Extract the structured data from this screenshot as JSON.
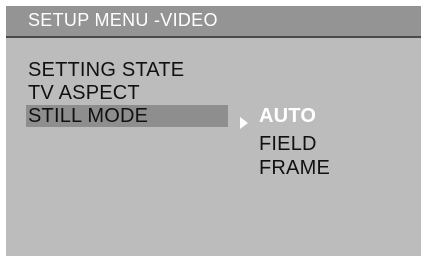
{
  "header": {
    "title": "SETUP MENU -VIDEO"
  },
  "menu": {
    "items": [
      {
        "label": "SETTING STATE"
      },
      {
        "label": "TV ASPECT"
      },
      {
        "label": "STILL MODE",
        "selected": true
      }
    ]
  },
  "submenu": {
    "options": [
      {
        "label": "AUTO",
        "selected": true
      },
      {
        "label": "FIELD"
      },
      {
        "label": "FRAME"
      }
    ]
  },
  "colors": {
    "screen_background": "#bcbcbc",
    "title_bar": "#949494",
    "highlight": "#8e8e8e",
    "text": "#111111",
    "selected_text": "#ffffff"
  }
}
